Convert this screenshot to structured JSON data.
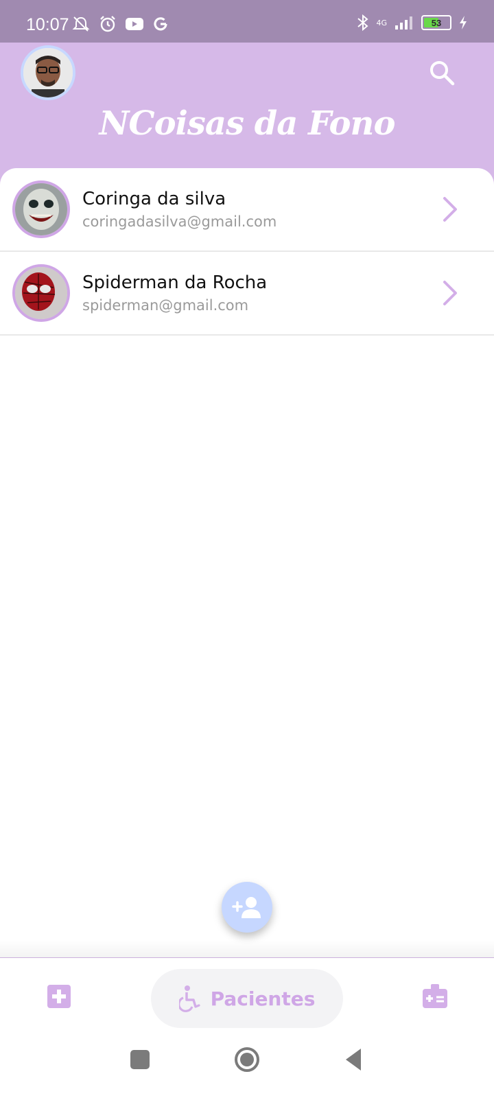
{
  "status_bar": {
    "time": "10:07",
    "network_label": "4G",
    "battery_percent": "53",
    "icons": [
      "mute-icon",
      "alarm-icon",
      "youtube-icon",
      "google-icon",
      "bluetooth-icon",
      "signal-icon",
      "charging-icon"
    ]
  },
  "header": {
    "title": "NCoisas da Fono",
    "search_icon": "search-icon"
  },
  "patients": [
    {
      "name": "Coringa da silva",
      "email": "coringadasilva@gmail.com"
    },
    {
      "name": "Spiderman da Rocha",
      "email": "spiderman@gmail.com"
    }
  ],
  "fab": {
    "icon": "add-person-icon"
  },
  "bottom_nav": {
    "left_icon": "medical-plus-icon",
    "active_label": "Pacientes",
    "active_icon": "accessible-icon",
    "right_icon": "medical-kit-icon"
  },
  "colors": {
    "primary": "#d6b9e8",
    "accent": "#cfa6e6",
    "status_bar": "#a08ab0",
    "fab": "#c6d7ff"
  }
}
